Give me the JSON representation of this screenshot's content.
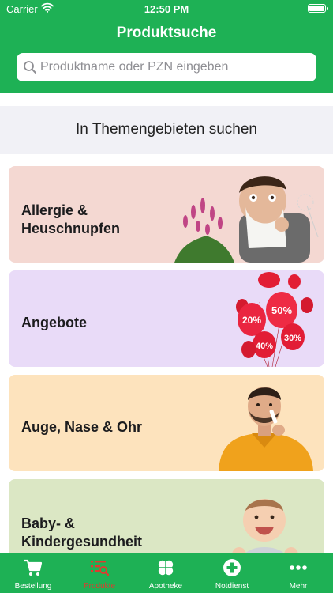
{
  "status_bar": {
    "carrier": "Carrier",
    "time": "12:50 PM"
  },
  "header": {
    "title": "Produktsuche"
  },
  "search": {
    "placeholder": "Produktname oder PZN eingeben"
  },
  "section": {
    "heading": "In Themengebieten suchen"
  },
  "categories": [
    {
      "line1": "Allergie &",
      "line2": "Heuschnupfen",
      "bg": "#f4d8d2"
    },
    {
      "line1": "Angebote",
      "line2": "",
      "bg": "#e9dbf8"
    },
    {
      "line1": "Auge, Nase & Ohr",
      "line2": "",
      "bg": "#fde3bd"
    },
    {
      "line1": "Baby- &",
      "line2": "Kindergesundheit",
      "bg": "#dbe7c4"
    }
  ],
  "offers_badges": [
    "50%",
    "20%",
    "40%",
    "30%"
  ],
  "tabs": [
    {
      "label": "Bestellung",
      "icon": "cart-icon",
      "active": false
    },
    {
      "label": "Produkte",
      "icon": "product-search-icon",
      "active": true
    },
    {
      "label": "Apotheke",
      "icon": "clover-icon",
      "active": false
    },
    {
      "label": "Notdienst",
      "icon": "emergency-cross-icon",
      "active": false
    },
    {
      "label": "Mehr",
      "icon": "more-dots-icon",
      "active": false
    }
  ],
  "colors": {
    "brand_green": "#1eb155",
    "active_tab": "#e03a2f"
  }
}
